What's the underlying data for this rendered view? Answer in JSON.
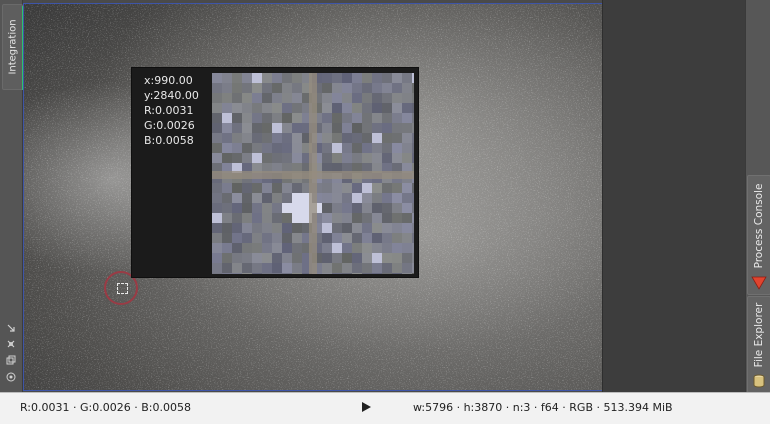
{
  "left_panel": {
    "tab_label": "Integration",
    "icons": [
      "arrow-down-right-icon",
      "close-x-icon",
      "window-stack-icon",
      "target-icon"
    ]
  },
  "readout": {
    "x": "x:990.00",
    "y": "y:2840.00",
    "r": "R:0.0031",
    "g": "G:0.0026",
    "b": "B:0.0058"
  },
  "right_panel": {
    "tab_process_console": "Process Console",
    "tab_file_explorer": "File Explorer"
  },
  "status": {
    "left": "R:0.0031 · G:0.0026 · B:0.0058",
    "right": "w:5796 · h:3870 · n:3 · f64 · RGB · 513.394 MiB",
    "play_icon": "play-icon"
  },
  "colors": {
    "viewer_border": "#3e55a8",
    "accent_green": "#2ec46d",
    "cursor_ring": "#9a3b45",
    "process_icon": "#e0442f"
  }
}
